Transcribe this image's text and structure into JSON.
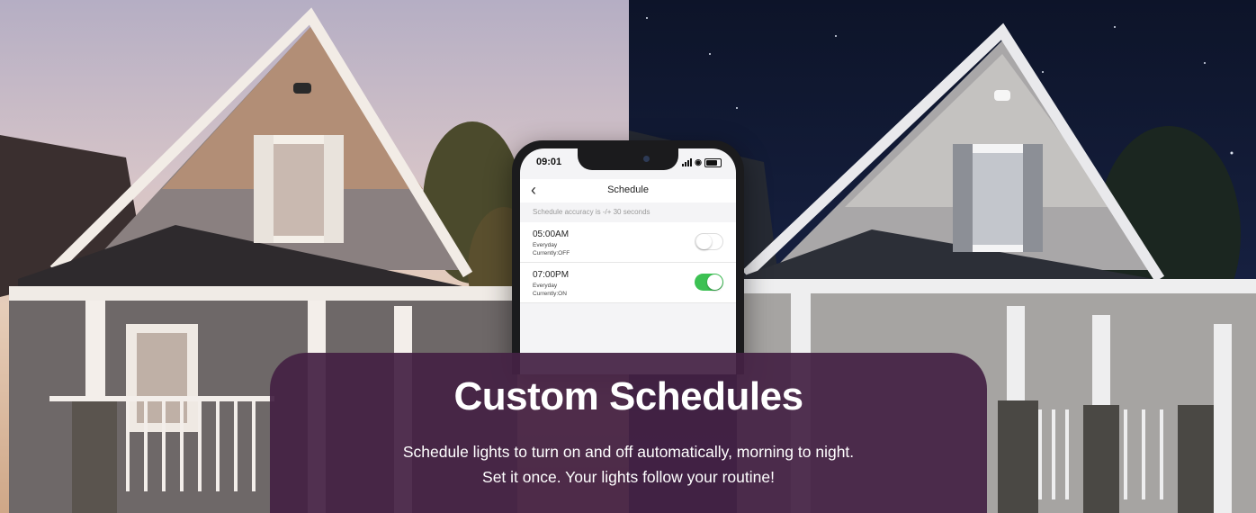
{
  "banner": {
    "title": "Custom Schedules",
    "line1": "Schedule lights to turn on and off automatically, morning to night.",
    "line2": "Set it once. Your lights follow your routine!"
  },
  "phone": {
    "status_time": "09:01",
    "back_icon": "chevron-left-icon",
    "title": "Schedule",
    "accuracy_note": "Schedule accuracy is -/+ 30 seconds",
    "schedules": [
      {
        "time": "05:00AM",
        "repeat": "Everyday",
        "current": "Currently:OFF",
        "enabled": false
      },
      {
        "time": "07:00PM",
        "repeat": "Everyday",
        "current": "Currently:ON",
        "enabled": true
      }
    ],
    "toggle_on_color": "#3cc153"
  },
  "colors": {
    "banner_bg": "#442144"
  }
}
